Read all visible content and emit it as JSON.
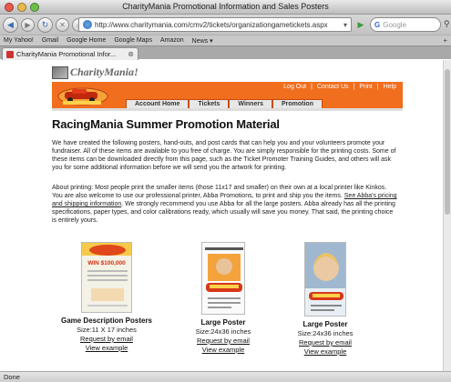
{
  "window": {
    "title": "CharityMania Promotional Information and Sales Posters"
  },
  "toolbar": {
    "url": "http://www.charitymania.com/cmv2/tickets/organizationgametickets.aspx",
    "search_placeholder": "Google"
  },
  "bookmarks": [
    "My Yahoo!",
    "Gmail",
    "Google Home",
    "Google Maps",
    "Amazon",
    "News ▾"
  ],
  "tab": {
    "label": "CharityMania Promotional Infor..."
  },
  "site": {
    "logo_text": "CharityMania!",
    "top_links": [
      "Log Out",
      "|",
      "Contact Us",
      "|",
      "Print",
      "|",
      "Help"
    ],
    "nav_tabs": [
      "Account Home",
      "Tickets",
      "Winners",
      "Promotion"
    ]
  },
  "content": {
    "heading": "RacingMania Summer  Promotion Material",
    "para1": "We have created the following posters, hand-outs, and post cards that can help you and your volunteers promote your fundraiser. All of these items are available to you free of charge. You are simply responsible for the printing costs. Some of these items can be downloaded directly from this page, such as the Ticket Promoter Training Guides, and others will ask you for some additional information before we will send you the artwork for printing.",
    "para2_a": "About printing: Most people print the smaller items (those 11x17 and smaller) on their own at a local printer like Kinkos. You are also welcome to use our professional printer, Abba Promotions, to print and ship you the items. ",
    "para2_link": "See Abba's pricing and shipping information",
    "para2_b": ". We strongly recommend you use Abba for all the large posters. Abba already has all the printing specifications, paper types, and color calibrations ready, which usually will save you money. That said, the printing choice is entirely yours.",
    "items": [
      {
        "name": "Game Description Posters",
        "size": "Size:11 X 17 inches",
        "request": "Request by email",
        "view": "View example",
        "poster_text": "WIN $100,000"
      },
      {
        "name": "Large Poster",
        "size": "Size:24x36 inches",
        "request": "Request by email",
        "view": "View example"
      },
      {
        "name": "Large Poster",
        "size": "Size:24x36 inches",
        "request": "Request by email",
        "view": "View example"
      }
    ]
  },
  "status": {
    "text": "Done"
  },
  "colors": {
    "brand_orange": "#f06e1e"
  }
}
